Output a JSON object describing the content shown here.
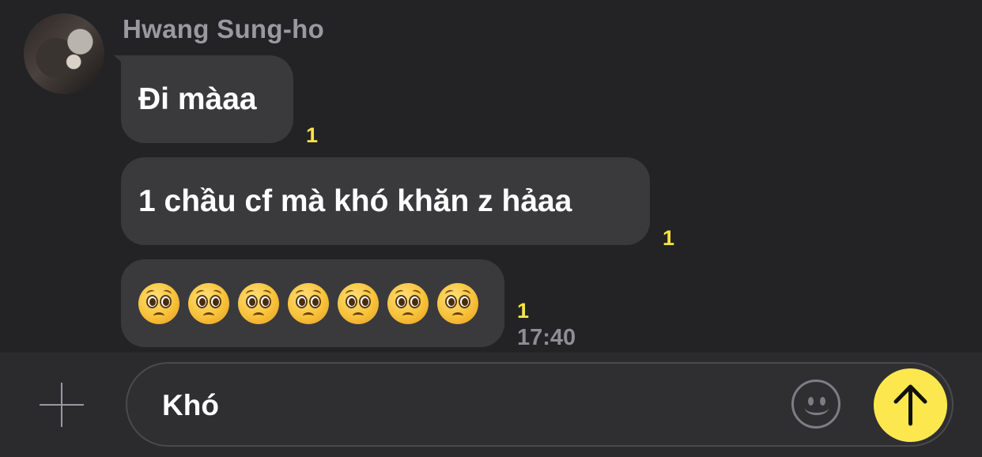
{
  "conversation": {
    "sender_name": "Hwang Sung-ho",
    "messages": [
      {
        "text": "Đi màaa",
        "unread": "1"
      },
      {
        "text": "1 chầu cf mà khó khăn z hảaa",
        "unread": "1"
      },
      {
        "emoji": "pleading-face",
        "emoji_count": 7,
        "unread": "1",
        "time": "17:40"
      }
    ]
  },
  "composer": {
    "input_value": "Khó",
    "icons": {
      "attach": "plus-icon",
      "emoji": "emoji-smiley-icon",
      "send": "arrow-up-icon"
    },
    "send_color": "#fce84e"
  },
  "colors": {
    "unread_badge": "#f7e24a",
    "bubble": "#3a3a3c",
    "background": "#232325"
  }
}
